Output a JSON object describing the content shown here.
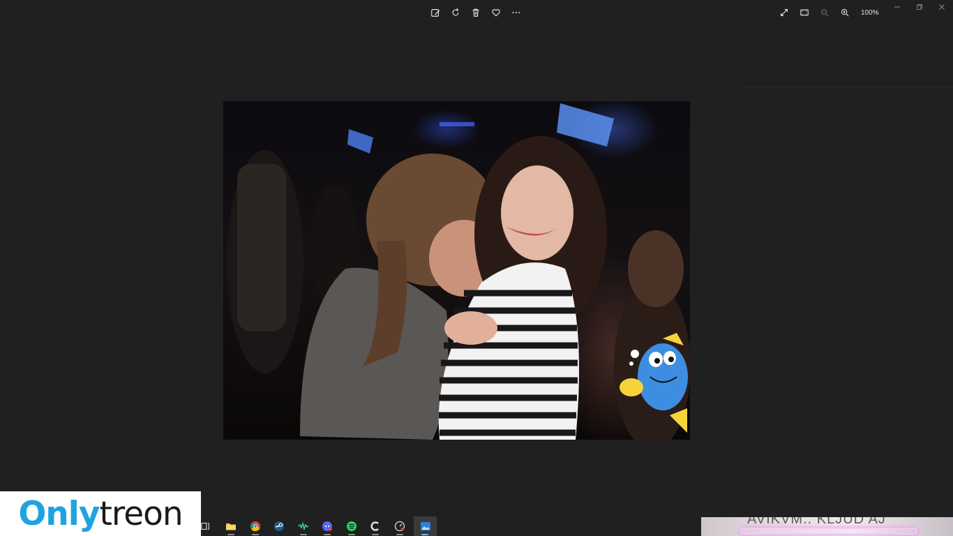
{
  "toolbar": {
    "items": [
      {
        "name": "edit-image-icon",
        "label": "Edit image"
      },
      {
        "name": "rotate-icon",
        "label": "Rotate"
      },
      {
        "name": "delete-icon",
        "label": "Delete"
      },
      {
        "name": "favorite-icon",
        "label": "Favorite"
      },
      {
        "name": "more-options-icon",
        "label": "More"
      }
    ]
  },
  "view": {
    "zoom_level": "100%"
  },
  "watermark": {
    "part_a": "Only",
    "part_b": "treon"
  },
  "corner_thumbnail": {
    "text": "AVIKVM.. KLJUD AJ"
  },
  "taskbar": {
    "icons": [
      "task-view-icon",
      "file-explorer-icon",
      "chrome-icon",
      "steam-icon",
      "audio-app-icon",
      "discord-icon",
      "spotify-icon",
      "ccleaner-icon",
      "speedometer-icon",
      "photos-app-icon"
    ]
  }
}
